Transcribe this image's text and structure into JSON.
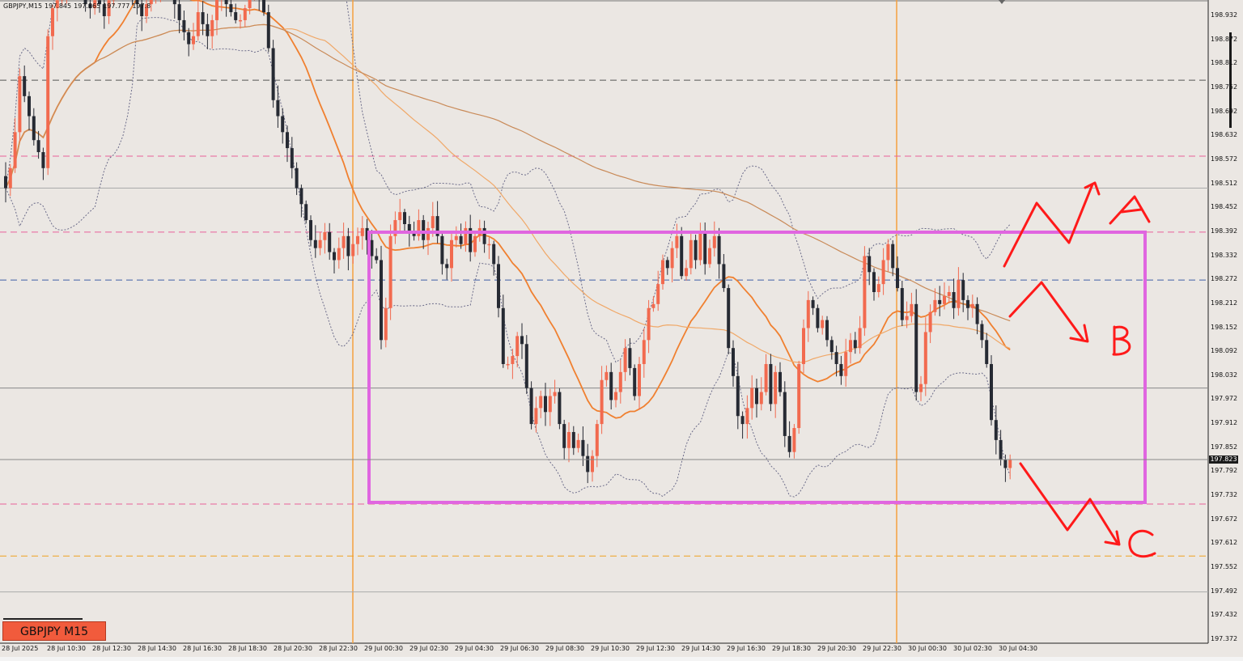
{
  "header": {
    "symbol": "GBPJPY,M15",
    "ohlc": [
      "197.845",
      "197.865",
      "197.777",
      "197.8"
    ]
  },
  "badge": {
    "label": "GBPJPY M15"
  },
  "colors": {
    "background": "#ebe7e3",
    "bull": "#f26a4f",
    "bear": "#262a33",
    "box": "#e066e0",
    "annotation": "#ff1a1a",
    "ma_fast": "#f08030",
    "ma_slow": "#f0a868",
    "ma_long": "#c98a58",
    "bollinger": "#6c6c8a",
    "level_pink": "#e8609a",
    "level_blue": "#4060a8",
    "level_orange": "#f0a020",
    "level_gray": "#555555"
  },
  "chart_data": {
    "type": "candlestick",
    "symbol": "GBPJPY",
    "timeframe": "M15",
    "ylim": [
      197.37,
      198.97
    ],
    "price_ticks": [
      "198.932",
      "198.872",
      "198.812",
      "198.752",
      "198.692",
      "198.632",
      "198.572",
      "198.512",
      "198.452",
      "198.392",
      "198.332",
      "198.272",
      "198.212",
      "198.152",
      "198.092",
      "198.032",
      "197.972",
      "197.912",
      "197.852",
      "197.792",
      "197.732",
      "197.672",
      "197.612",
      "197.552",
      "197.492",
      "197.432",
      "197.372"
    ],
    "time_ticks": [
      "28 Jul 2025",
      "28 Jul 10:30",
      "28 Jul 12:30",
      "28 Jul 14:30",
      "28 Jul 16:30",
      "28 Jul 18:30",
      "28 Jul 20:30",
      "28 Jul 22:30",
      "29 Jul 00:30",
      "29 Jul 02:30",
      "29 Jul 04:30",
      "29 Jul 06:30",
      "29 Jul 08:30",
      "29 Jul 10:30",
      "29 Jul 12:30",
      "29 Jul 14:30",
      "29 Jul 16:30",
      "29 Jul 18:30",
      "29 Jul 20:30",
      "29 Jul 22:30",
      "30 Jul 00:30",
      "30 Jul 02:30",
      "30 Jul 04:30"
    ],
    "current_price": "197.823",
    "closes": [
      198.5,
      198.55,
      198.64,
      198.78,
      198.73,
      198.68,
      198.62,
      198.59,
      198.55,
      198.88,
      198.95,
      198.97,
      198.98,
      199.0,
      199.0,
      199.01,
      198.98,
      198.96,
      198.95,
      198.97,
      198.96,
      198.93,
      198.97,
      199.0,
      199.01,
      199.02,
      199.02,
      198.99,
      198.96,
      198.93,
      198.96,
      198.99,
      199.0,
      199.01,
      199.03,
      199.05,
      198.96,
      198.92,
      198.89,
      198.86,
      198.88,
      198.94,
      198.91,
      198.88,
      198.92,
      198.98,
      199.0,
      198.96,
      198.94,
      198.92,
      198.92,
      198.95,
      198.98,
      199.05,
      198.98,
      198.94,
      198.85,
      198.72,
      198.68,
      198.64,
      198.6,
      198.55,
      198.5,
      198.46,
      198.42,
      198.37,
      198.35,
      198.37,
      198.39,
      198.34,
      198.32,
      198.35,
      198.38,
      198.33,
      198.36,
      198.38,
      198.4,
      198.37,
      198.33,
      198.32,
      198.12,
      198.2,
      198.38,
      198.42,
      198.44,
      198.41,
      198.39,
      198.38,
      198.42,
      198.37,
      198.4,
      198.43,
      198.38,
      198.31,
      198.3,
      198.37,
      198.38,
      198.36,
      198.4,
      198.34,
      198.38,
      198.4,
      198.36,
      198.36,
      198.31,
      198.2,
      198.06,
      198.06,
      198.08,
      198.13,
      198.11,
      198.0,
      197.91,
      197.95,
      197.98,
      197.94,
      197.98,
      197.99,
      197.91,
      197.85,
      197.89,
      197.85,
      197.87,
      197.83,
      197.79,
      197.83,
      197.91,
      198.02,
      198.04,
      197.97,
      197.99,
      198.04,
      198.1,
      198.05,
      197.98,
      198.06,
      198.12,
      198.2,
      198.21,
      198.26,
      198.32,
      198.3,
      198.35,
      198.38,
      198.28,
      198.3,
      198.37,
      198.32,
      198.39,
      198.31,
      198.35,
      198.38,
      198.31,
      198.25,
      198.1,
      198.03,
      197.93,
      197.91,
      197.95,
      198.0,
      197.96,
      197.99,
      198.06,
      197.96,
      198.04,
      197.99,
      197.88,
      197.84,
      197.9,
      198.06,
      198.15,
      198.22,
      198.2,
      198.15,
      198.17,
      198.12,
      198.09,
      198.06,
      198.03,
      198.09,
      198.12,
      198.1,
      198.15,
      198.33,
      198.29,
      198.24,
      198.26,
      198.32,
      198.36,
      198.3,
      198.25,
      198.17,
      198.18,
      198.21,
      197.99,
      198.01,
      198.14,
      198.19,
      198.22,
      198.21,
      198.23,
      198.24,
      198.2,
      198.27,
      198.22,
      198.2,
      198.21,
      198.16,
      198.12,
      198.06,
      197.92,
      197.87,
      197.82,
      197.8,
      197.82
    ]
  },
  "levels": [
    {
      "name": "gray-dashed-level",
      "price": 198.77,
      "color": "#555555"
    },
    {
      "name": "pink-dashed-upper",
      "price": 198.58,
      "color": "#e8609a"
    },
    {
      "name": "pink-dashed-mid",
      "price": 198.39,
      "color": "#e8609a"
    },
    {
      "name": "blue-dashed-level",
      "price": 198.27,
      "color": "#4060a8"
    },
    {
      "name": "gray-solid-level",
      "price": 198.0,
      "color": "#888888"
    },
    {
      "name": "pink-dashed-lower",
      "price": 197.71,
      "color": "#e8609a"
    },
    {
      "name": "orange-dashed-level",
      "price": 197.58,
      "color": "#f0a020"
    },
    {
      "name": "gray-solid-light-upper",
      "price": 198.5,
      "color": "#aaaaaa"
    },
    {
      "name": "gray-solid-light-lower",
      "price": 197.49,
      "color": "#aaaaaa"
    }
  ],
  "range_box": {
    "top_price": 198.39,
    "bottom_price": 197.72,
    "color": "#e066e0"
  },
  "scenarios": [
    {
      "label": "A",
      "direction": "breakout-up"
    },
    {
      "label": "B",
      "direction": "rejection-down-inside-range"
    },
    {
      "label": "C",
      "direction": "breakdown-down"
    }
  ]
}
